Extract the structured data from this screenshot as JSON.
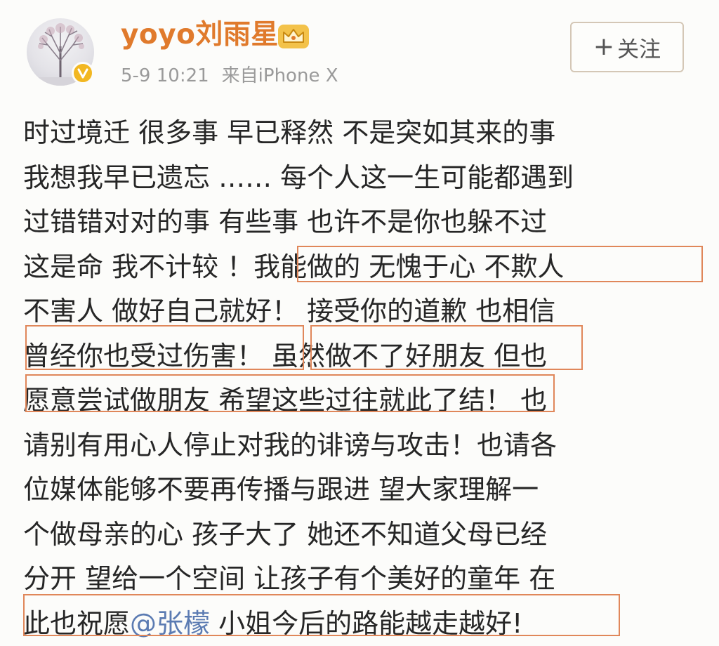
{
  "post": {
    "author": {
      "name": "yoyo刘雨星",
      "avatar_icon": "avatar-tree-photo",
      "verified_icon": "verified-badge-icon",
      "vip_icon": "crown-icon"
    },
    "time": "5-9 10:21",
    "source": "来自iPhone X",
    "follow_label": "关注",
    "follow_icon": "plus-icon",
    "lines": [
      "时过境迁 很多事 早已释然 不是突如其来的事",
      "我想我早已遗忘 …… 每个人这一生可能都遇到",
      "过错错对对的事 有些事 也许不是你也躲不过",
      "这是命 我不计较 ！我能做的 无愧于心 不欺人",
      "不害人 做好自己就好！ 接受你的道歉 也相信",
      "曾经你也受过伤害！ 虽然做不了好朋友 但也",
      "愿意尝试做朋友 希望这些过往就此了结！ 也",
      "请别有用心人停止对我的诽谤与攻击！也请各",
      "位媒体能够不要再传播与跟进  望大家理解一",
      "个做母亲的心 孩子大了 她还不知道父母已经",
      "分开 望给一个空间 让孩子有个美好的童年 在"
    ],
    "last_line": {
      "before": "此也祝愿",
      "mention": "@张檬",
      "after": " 小姐今后的路能越走越好!"
    },
    "colors": {
      "author": "#e07a2c",
      "meta": "#9a9a9a",
      "highlight_box": "#e0875a",
      "mention": "#5b7bb2",
      "verified": "#f2b722"
    }
  }
}
